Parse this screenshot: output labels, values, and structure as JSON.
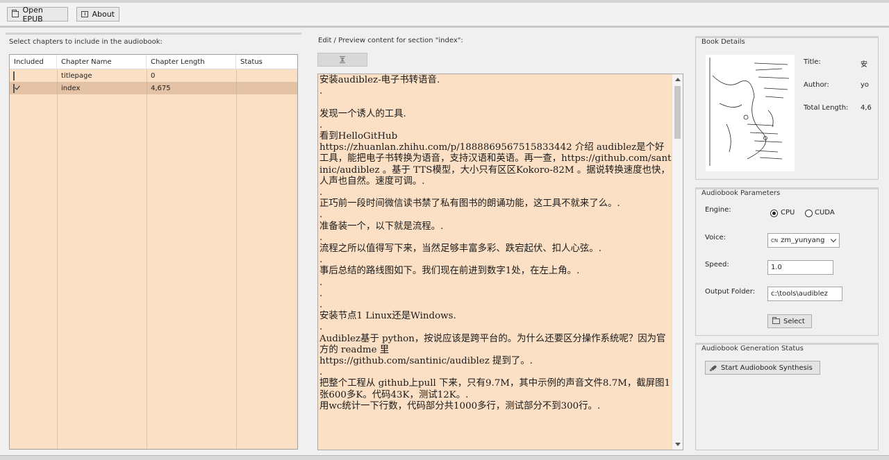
{
  "toolbar": {
    "open_label": "Open EPUB",
    "about_label": "About"
  },
  "chapters": {
    "title": "Select chapters to include in the audiobook:",
    "columns": [
      "Included",
      "Chapter Name",
      "Chapter Length",
      "Status"
    ],
    "rows": [
      {
        "included": false,
        "name": "titlepage",
        "length": "0",
        "status": ""
      },
      {
        "included": true,
        "name": "index",
        "length": "4,675",
        "status": ""
      }
    ]
  },
  "editor": {
    "title": "Edit / Preview content for section \"index\":",
    "content": "安装audiblez-电子书转语音.\n.\n\n发现一个诱人的工具.\n.\n看到HelloGitHub\nhttps://zhuanlan.zhihu.com/p/1888869567515833442 介绍 audiblez是个好工具，能把电子书转换为语音，支持汉语和英语。再一查，https://github.com/santinic/audiblez 。基于 TTS模型，大小只有区区Kokoro-82M 。据说转换速度也快，人声也自然。速度可调。.\n.\n正巧前一段时间微信读书禁了私有图书的朗诵功能，这工具不就来了么。.\n.\n准备装一个，以下就是流程。.\n.\n流程之所以值得写下来，当然足够丰富多彩、跌宕起伏、扣人心弦。.\n.\n事后总结的路线图如下。我们现在前进到数字1处，在左上角。.\n.\n.\n.\n安装节点1 Linux还是Windows.\n.\nAudiblez基于 python，按说应该是跨平台的。为什么还要区分操作系统呢？因为官方的 readme 里\nhttps://github.com/santinic/audiblez 提到了。.\n.\n把整个工程从 github上pull 下来，只有9.7M，其中示例的声音文件8.7M，截屏图1张600多K。代码43K，测试12K。.\n用wc统计一下行数，代码部分共1000多行，测试部分不到300行。."
  },
  "details": {
    "title": "Book Details",
    "title_label": "Title:",
    "title_value": "安",
    "author_label": "Author:",
    "author_value": "yo",
    "length_label": "Total Length:",
    "length_value": "4,6"
  },
  "params": {
    "title": "Audiobook Parameters",
    "engine_label": "Engine:",
    "engine_cpu": "CPU",
    "engine_cuda": "CUDA",
    "engine_selected": "CPU",
    "voice_label": "Voice:",
    "voice_flag": "CN",
    "voice_value": "zm_yunyang",
    "speed_label": "Speed:",
    "speed_value": "1.0",
    "output_label": "Output Folder:",
    "output_value": "c:\\tools\\audiblez",
    "select_label": "Select"
  },
  "status": {
    "title": "Audiobook Generation Status",
    "start_label": "Start Audiobook Synthesis"
  },
  "icons": {
    "open": "folder-icon",
    "about": "info-icon",
    "preview": "hourglass-icon",
    "select": "folder-icon",
    "start": "rocket-icon"
  },
  "colors": {
    "content_bg": "#fbe0c5",
    "selected_row": "#e3c2a6"
  }
}
